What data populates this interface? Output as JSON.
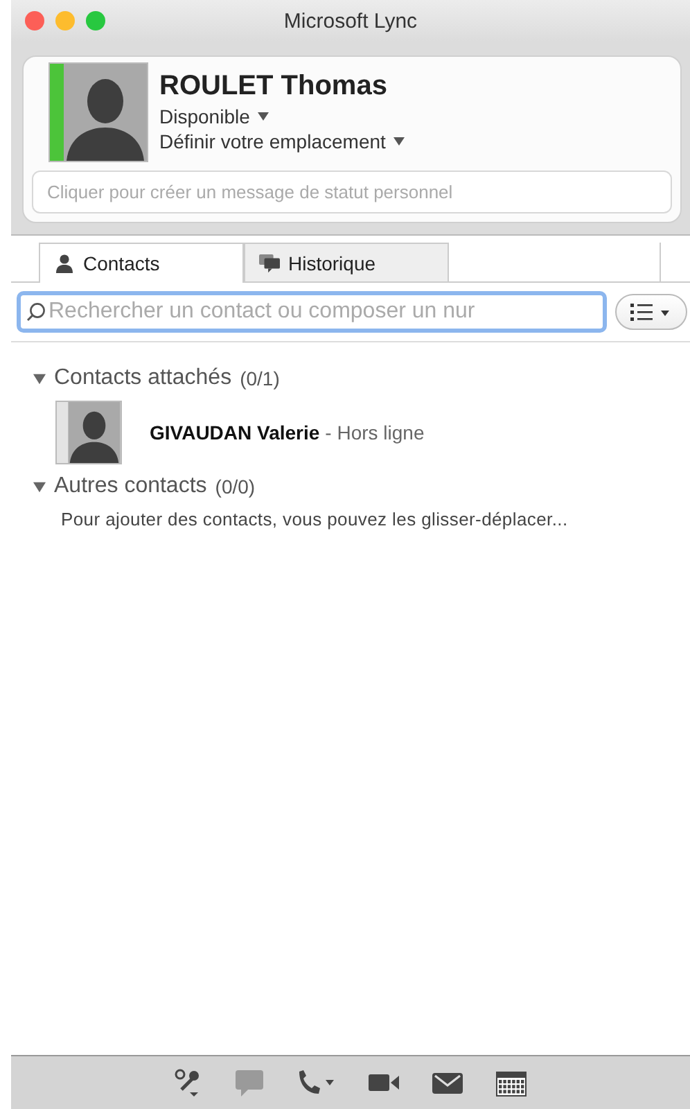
{
  "window": {
    "title": "Microsoft Lync"
  },
  "profile": {
    "name": "ROULET Thomas",
    "color": "#4cc43a",
    "status": "Disponible",
    "location": "Définir votre emplacement",
    "status_message": {
      "placeholder": "Cliquer pour créer un message de statut personnel"
    }
  },
  "tabs": [
    {
      "label": "Contacts",
      "kind": "person",
      "selected": true
    },
    {
      "label": "Historique",
      "kind": "chat",
      "selected": false
    }
  ],
  "search": {
    "placeholder": "Rechercher un contact ou composer un nur"
  },
  "groups": [
    {
      "title": "Contacts attachés",
      "count": "(0/1)",
      "expanded": true,
      "contacts": [
        {
          "name": "GIVAUDAN Valerie",
          "color": "#e4e4e4",
          "status": "- Hors ligne"
        }
      ]
    },
    {
      "title": "Autres contacts",
      "count": "(0/0)",
      "expanded": true,
      "note": "Pour ajouter des contacts, vous pouvez les glisser-déplacer..."
    }
  ],
  "toolbar": [
    {
      "kind": "audio",
      "disabled": false
    },
    {
      "kind": "chat",
      "disabled": true
    },
    {
      "kind": "call",
      "disabled": false
    },
    {
      "kind": "video",
      "disabled": false
    },
    {
      "kind": "mail",
      "disabled": false
    },
    {
      "kind": "calendar",
      "disabled": false
    }
  ]
}
